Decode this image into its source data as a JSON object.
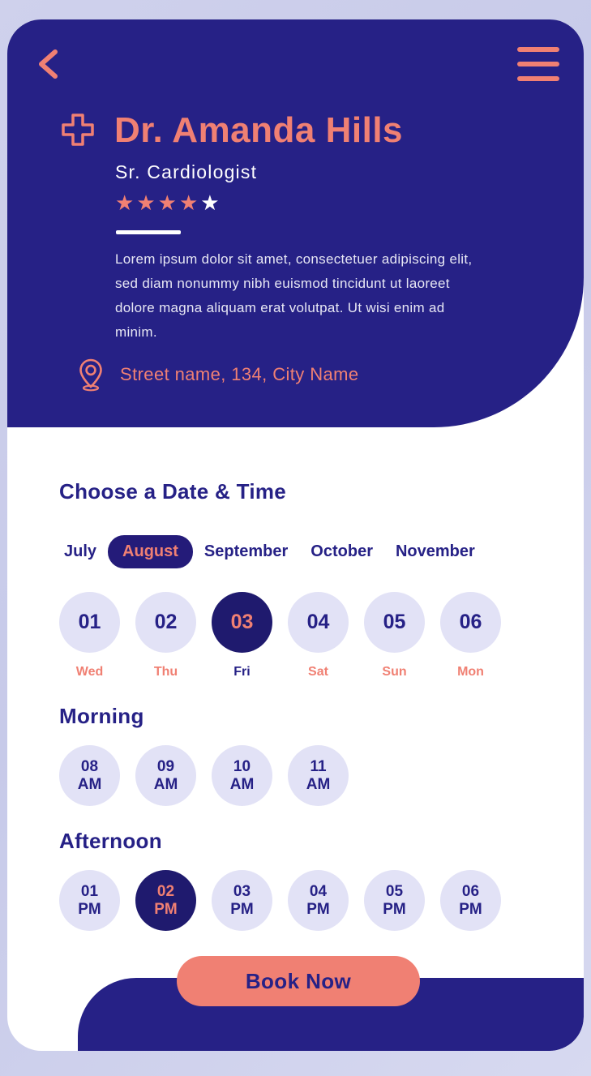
{
  "colors": {
    "navy": "#262186",
    "navy_dark": "#1f1a6e",
    "coral": "#f08073",
    "lavender": "#e2e2f6",
    "page_bg": "#c7cae9",
    "white": "#ffffff"
  },
  "header": {
    "back_icon": "chevron-left-icon",
    "menu_icon": "hamburger-menu-icon",
    "cross_icon": "medical-cross-icon",
    "doctor_name": "Dr. Amanda Hills",
    "specialty": "Sr. Cardiologist",
    "rating": {
      "value": 4,
      "max": 5,
      "filled_glyph": "★",
      "empty_glyph": "★"
    },
    "bio": "Lorem ipsum dolor sit amet, consectetuer adipiscing elit, sed diam nonummy nibh euismod tincidunt ut laoreet dolore magna aliquam erat volutpat. Ut wisi enim ad minim.",
    "location_icon": "map-pin-icon",
    "location": "Street name, 134, City Name"
  },
  "booking": {
    "title": "Choose a Date & Time",
    "months": [
      {
        "label": "July",
        "selected": false
      },
      {
        "label": "August",
        "selected": true
      },
      {
        "label": "September",
        "selected": false
      },
      {
        "label": "October",
        "selected": false
      },
      {
        "label": "November",
        "selected": false
      }
    ],
    "dates": [
      {
        "date": "01",
        "day": "Wed",
        "selected": false
      },
      {
        "date": "02",
        "day": "Thu",
        "selected": false
      },
      {
        "date": "03",
        "day": "Fri",
        "selected": true
      },
      {
        "date": "04",
        "day": "Sat",
        "selected": false
      },
      {
        "date": "05",
        "day": "Sun",
        "selected": false
      },
      {
        "date": "06",
        "day": "Mon",
        "selected": false
      }
    ],
    "morning": {
      "title": "Morning",
      "slots": [
        {
          "hour": "08",
          "period": "AM",
          "selected": false
        },
        {
          "hour": "09",
          "period": "AM",
          "selected": false
        },
        {
          "hour": "10",
          "period": "AM",
          "selected": false
        },
        {
          "hour": "11",
          "period": "AM",
          "selected": false
        }
      ]
    },
    "afternoon": {
      "title": "Afternoon",
      "slots": [
        {
          "hour": "01",
          "period": "PM",
          "selected": false
        },
        {
          "hour": "02",
          "period": "PM",
          "selected": true
        },
        {
          "hour": "03",
          "period": "PM",
          "selected": false
        },
        {
          "hour": "04",
          "period": "PM",
          "selected": false
        },
        {
          "hour": "05",
          "period": "PM",
          "selected": false
        },
        {
          "hour": "06",
          "period": "PM",
          "selected": false
        }
      ]
    },
    "book_button": "Book Now"
  }
}
